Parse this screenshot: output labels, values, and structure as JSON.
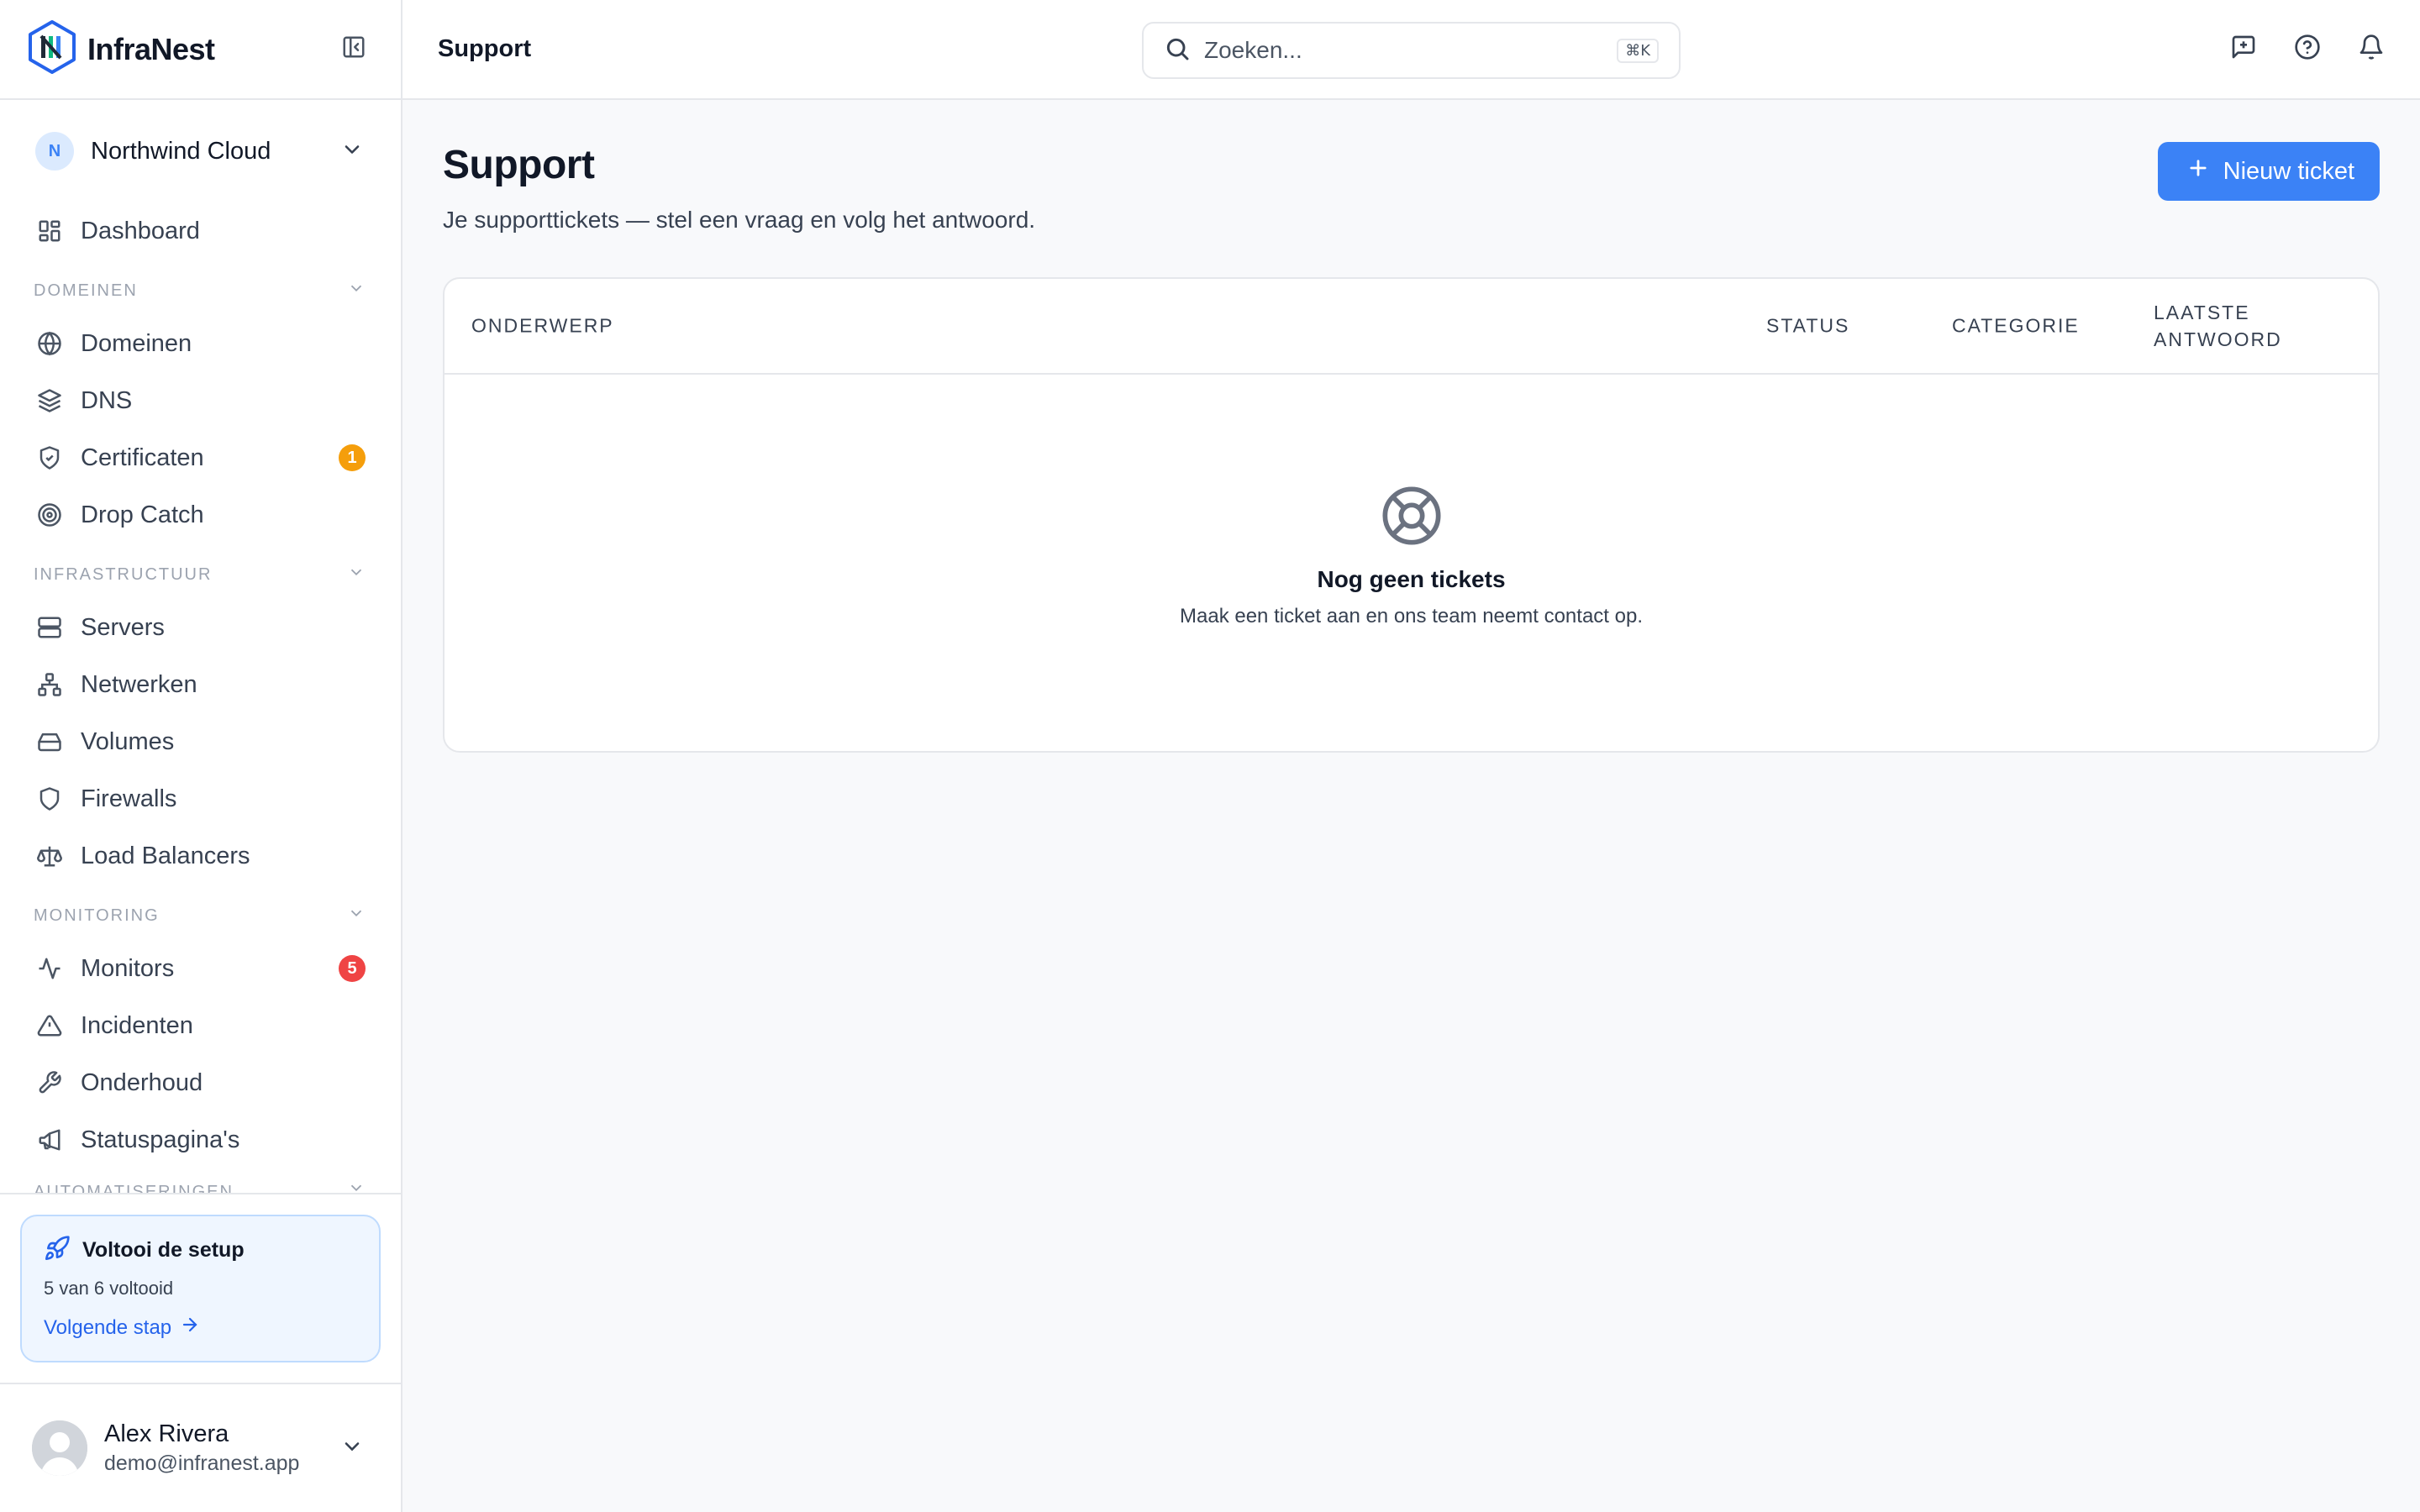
{
  "brand": {
    "name": "InfraNest"
  },
  "org": {
    "initial": "N",
    "name": "Northwind Cloud"
  },
  "nav": {
    "dashboard": "Dashboard",
    "sections": {
      "domains": "DOMEINEN",
      "infra": "INFRASTRUCTUUR",
      "monitoring": "MONITORING",
      "automation": "AUTOMATISERINGEN"
    },
    "items": {
      "domains": "Domeinen",
      "dns": "DNS",
      "certificates": "Certificaten",
      "dropcatch": "Drop Catch",
      "servers": "Servers",
      "networks": "Netwerken",
      "volumes": "Volumes",
      "firewalls": "Firewalls",
      "loadbalancers": "Load Balancers",
      "monitors": "Monitors",
      "incidents": "Incidenten",
      "maintenance": "Onderhoud",
      "statuspages": "Statuspagina's"
    },
    "badges": {
      "certificates": "1",
      "monitors": "5"
    }
  },
  "setup": {
    "title": "Voltooi de setup",
    "progress": "5 van 6 voltooid",
    "next": "Volgende stap"
  },
  "user": {
    "name": "Alex Rivera",
    "email": "demo@infranest.app"
  },
  "topbar": {
    "title": "Support",
    "search_placeholder": "Zoeken...",
    "shortcut": "⌘K"
  },
  "page": {
    "title": "Support",
    "subtitle": "Je supporttickets — stel een vraag en volg het antwoord.",
    "new_button": "Nieuw ticket"
  },
  "table": {
    "columns": [
      "ONDERWERP",
      "STATUS",
      "CATEGORIE",
      "LAATSTE ANTWOORD"
    ],
    "rows": []
  },
  "empty": {
    "title": "Nog geen tickets",
    "subtitle": "Maak een ticket aan en ons team neemt contact op."
  },
  "colors": {
    "accent": "#3b82f6",
    "badge_warning": "#f59e0b",
    "badge_danger": "#ef4444"
  }
}
